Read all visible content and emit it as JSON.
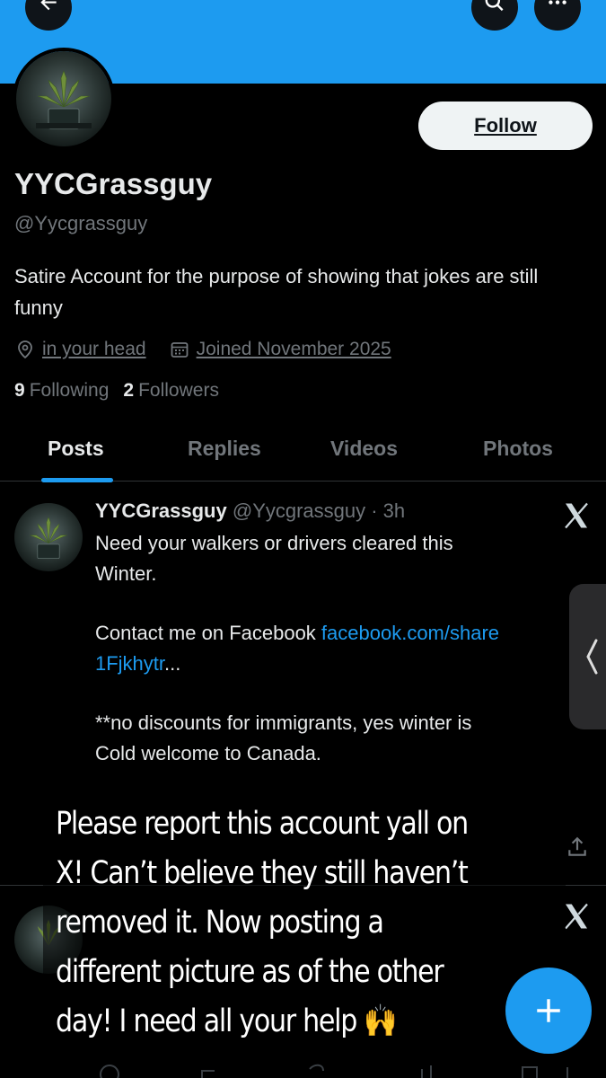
{
  "profile": {
    "display_name": "YYCGrassguy",
    "handle": "@Yycgrassguy",
    "bio": "Satire Account for the purpose of showing that jokes are still funny",
    "location": "in your head",
    "joined": "Joined November 2025",
    "following_count": "9",
    "following_label": "Following",
    "followers_count": "2",
    "followers_label": "Followers",
    "follow_label": "Follow"
  },
  "tabs": [
    {
      "label": "Posts",
      "active": true
    },
    {
      "label": "Replies",
      "active": false
    },
    {
      "label": "Videos",
      "active": false
    },
    {
      "label": "Photos",
      "active": false
    }
  ],
  "post": {
    "author": "YYCGrassguy",
    "meta": "@Yycgrassguy · 3h",
    "line1": "Need your walkers or drivers cleared this",
    "line2": "Winter.",
    "contact": "Contact me on Facebook ",
    "link_part1": "facebook.com/share",
    "link_part2": "1Fjkhytr",
    "ellipsis": "...",
    "line5": "**no discounts for immigrants, yes winter is",
    "line6": "Cold welcome to Canada."
  },
  "overlay": {
    "line1": "Please report this account yall on",
    "line2": "X! Can’t believe they still haven’t",
    "line3": "removed it. Now posting a",
    "line4": "different picture as of the other",
    "line5": "day! I need all your help 🙌"
  },
  "icons": [
    "back-arrow-icon",
    "search-icon",
    "more-icon",
    "location-icon",
    "calendar-icon",
    "grok-icon",
    "share-icon",
    "compose-plus-icon",
    "chevron-left-icon"
  ],
  "colors": {
    "accent": "#1d9bf0",
    "background": "#000000",
    "muted": "#71767b",
    "text": "#e7e9ea"
  }
}
